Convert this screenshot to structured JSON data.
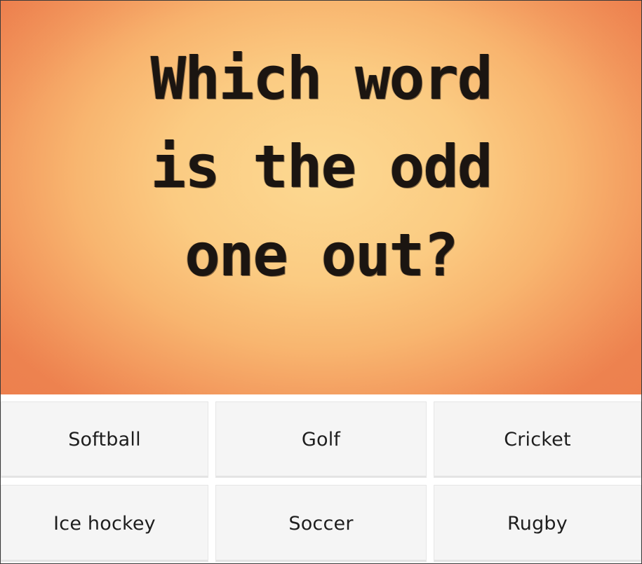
{
  "question": {
    "lines": [
      "Which word",
      "is the odd",
      "one out?"
    ]
  },
  "answers": [
    {
      "label": "Softball"
    },
    {
      "label": "Golf"
    },
    {
      "label": "Cricket"
    },
    {
      "label": "Ice hockey"
    },
    {
      "label": "Soccer"
    },
    {
      "label": "Rugby"
    }
  ],
  "colors": {
    "background_center": "#fcd992",
    "background_edge": "#ee8450",
    "question_text": "#1b1511",
    "tile_background": "#f5f5f5",
    "tile_text": "#1e1e1e"
  }
}
